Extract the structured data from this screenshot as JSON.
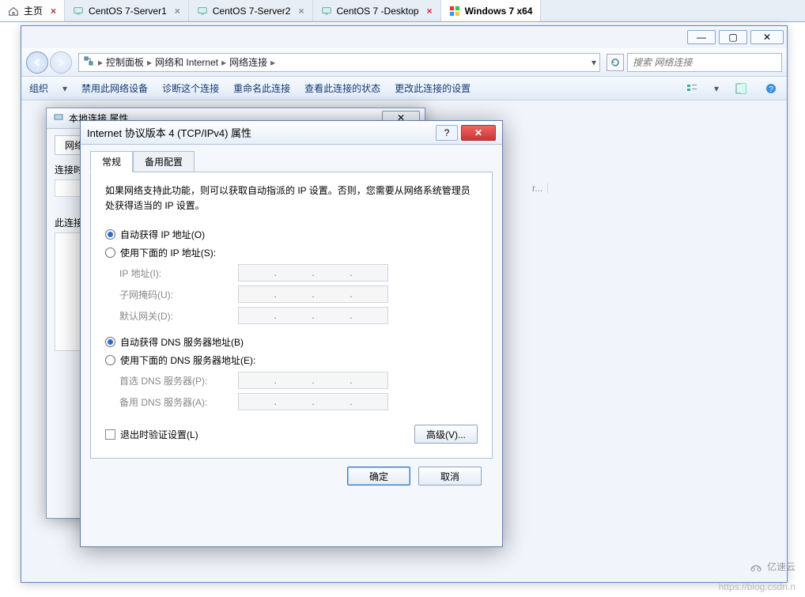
{
  "tabs": {
    "home": "主页",
    "t1": "CentOS 7-Server1",
    "t2": "CentOS 7-Server2",
    "t3": "CentOS 7 -Desktop",
    "t4": "Windows 7 x64"
  },
  "explorer": {
    "crumb1": "控制面板",
    "crumb2": "网络和 Internet",
    "crumb3": "网络连接",
    "search_placeholder": "搜索 网络连接",
    "toolbar": {
      "org": "组织",
      "disable": "禁用此网络设备",
      "diag": "诊断这个连接",
      "rename": "重命名此连接",
      "status": "查看此连接的状态",
      "change": "更改此连接的设置"
    }
  },
  "props_back": {
    "title": "本地连接 属性",
    "tab": "网络",
    "lbl_conn": "连接时使用:",
    "lbl_this": "此连接使用下列项目(O):"
  },
  "details_floating": "r...",
  "tcpip": {
    "title": "Internet 协议版本 4 (TCP/IPv4) 属性",
    "tab_general": "常规",
    "tab_alt": "备用配置",
    "desc": "如果网络支持此功能，则可以获取自动指派的 IP 设置。否则，您需要从网络系统管理员处获得适当的 IP 设置。",
    "r_auto_ip": "自动获得 IP 地址(O)",
    "r_manual_ip": "使用下面的 IP 地址(S):",
    "lbl_ip": "IP 地址(I):",
    "lbl_mask": "子网掩码(U):",
    "lbl_gw": "默认网关(D):",
    "r_auto_dns": "自动获得 DNS 服务器地址(B)",
    "r_manual_dns": "使用下面的 DNS 服务器地址(E):",
    "lbl_dns1": "首选 DNS 服务器(P):",
    "lbl_dns2": "备用 DNS 服务器(A):",
    "chk_validate": "退出时验证设置(L)",
    "btn_adv": "高级(V)...",
    "btn_ok": "确定",
    "btn_cancel": "取消"
  },
  "watermark": "https://blog.csdn.n",
  "brand": "亿速云"
}
